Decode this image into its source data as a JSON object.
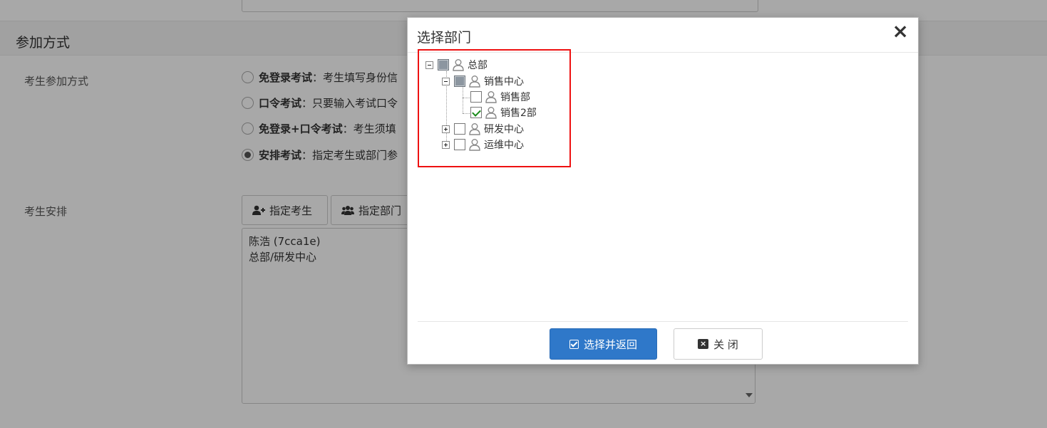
{
  "background": {
    "section_title": "参加方式",
    "join_mode_label": "考生参加方式",
    "options": [
      {
        "title": "免登录考试",
        "desc": "：考生填写身份信",
        "selected": false
      },
      {
        "title": "口令考试",
        "desc": "：只要输入考试口令",
        "selected": false
      },
      {
        "title": "免登录+口令考试",
        "desc": "：考生须填",
        "selected": false
      },
      {
        "title": "安排考试",
        "desc": "：指定考生或部门参",
        "selected": true
      }
    ],
    "arrange_label": "考生安排",
    "assign_student_btn": "指定考生",
    "assign_dept_btn": "指定部门",
    "assigned_lines": [
      "陈浩 (7cca1e)",
      "总部/研发中心"
    ]
  },
  "modal": {
    "title": "选择部门",
    "close_icon": "×",
    "tree": [
      {
        "label": "总部",
        "state": "partial",
        "expander": "minus"
      },
      {
        "label": "销售中心",
        "state": "partial",
        "expander": "minus"
      },
      {
        "label": "销售部",
        "state": "unchecked",
        "expander": "none"
      },
      {
        "label": "销售2部",
        "state": "checked",
        "expander": "none"
      },
      {
        "label": "研发中心",
        "state": "unchecked",
        "expander": "plus"
      },
      {
        "label": "运维中心",
        "state": "unchecked",
        "expander": "plus"
      }
    ],
    "confirm_button": "选择并返回",
    "close_button": "关 闭"
  },
  "colors": {
    "primary": "#2f78c9",
    "highlight": "#ee1111",
    "overlay": "rgba(0,0,0,0.34)"
  }
}
